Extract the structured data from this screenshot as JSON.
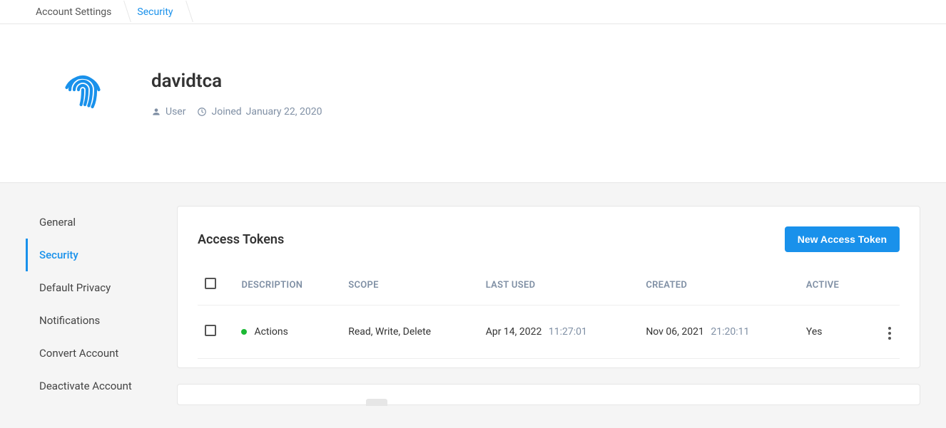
{
  "breadcrumb": [
    {
      "label": "Account Settings",
      "active": false
    },
    {
      "label": "Security",
      "active": true
    }
  ],
  "profile": {
    "username": "davidtca",
    "role": "User",
    "joined_prefix": "Joined",
    "joined_date": "January 22, 2020"
  },
  "sidebar": {
    "items": [
      {
        "label": "General",
        "active": false
      },
      {
        "label": "Security",
        "active": true
      },
      {
        "label": "Default Privacy",
        "active": false
      },
      {
        "label": "Notifications",
        "active": false
      },
      {
        "label": "Convert Account",
        "active": false
      },
      {
        "label": "Deactivate Account",
        "active": false
      }
    ]
  },
  "tokens_card": {
    "title": "Access Tokens",
    "new_button": "New Access Token",
    "columns": {
      "description": "DESCRIPTION",
      "scope": "SCOPE",
      "last_used": "LAST USED",
      "created": "CREATED",
      "active": "ACTIVE"
    },
    "rows": [
      {
        "status_color": "#1bb934",
        "description": "Actions",
        "scope": "Read, Write, Delete",
        "last_used_date": "Apr 14, 2022",
        "last_used_time": "11:27:01",
        "created_date": "Nov 06, 2021",
        "created_time": "21:20:11",
        "active": "Yes"
      }
    ]
  }
}
